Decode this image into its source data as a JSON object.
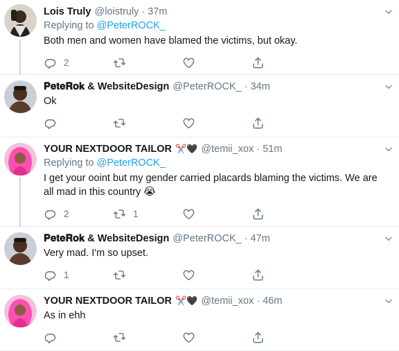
{
  "tweets": [
    {
      "name": "Lois Truly",
      "handle": "@loistruly",
      "dot": "·",
      "time": "37m",
      "replying_label": "Replying to",
      "replying_to": "@PeterROCK_",
      "text": "Both men and women have blamed the victims, but okay.",
      "reply_count": "2",
      "retweet_count": "",
      "like_count": ""
    },
    {
      "name": "𝐏𝐞𝐭𝐞𝐑𝐨𝐤 & WebsiteDesign",
      "handle": "@PeterROCK_",
      "dot": "·",
      "time": "34m",
      "text": "Ok",
      "reply_count": "",
      "retweet_count": "",
      "like_count": ""
    },
    {
      "name": "YOUR NEXTDOOR TAILOR",
      "name_emoji": "✂️🖤",
      "handle": "@temii_xox",
      "dot": "·",
      "time": "51m",
      "replying_label": "Replying to",
      "replying_to": "@PeterROCK_",
      "text": "I get your ooint but my gender carried placards blaming the victims. We are all mad in this country",
      "text_emoji": "😭",
      "reply_count": "2",
      "retweet_count": "1",
      "like_count": ""
    },
    {
      "name": "𝐏𝐞𝐭𝐞𝐑𝐨𝐤 & WebsiteDesign",
      "handle": "@PeterROCK_",
      "dot": "·",
      "time": "47m",
      "text": "Very mad. I'm so upset.",
      "reply_count": "1",
      "retweet_count": "",
      "like_count": ""
    },
    {
      "name": "YOUR NEXTDOOR TAILOR",
      "name_emoji": "✂️🖤",
      "handle": "@temii_xox",
      "dot": "·",
      "time": "46m",
      "text": "As in ehh",
      "reply_count": "",
      "retweet_count": "",
      "like_count": ""
    }
  ],
  "colors": {
    "accent": "#1da1f2",
    "secondary_text": "#657786",
    "primary_text": "#14171a",
    "divider": "#e6ecf0",
    "thread_line": "#ccd6dd"
  },
  "icons": [
    "reply-icon",
    "retweet-icon",
    "like-icon",
    "share-icon",
    "chevron-down-icon"
  ]
}
